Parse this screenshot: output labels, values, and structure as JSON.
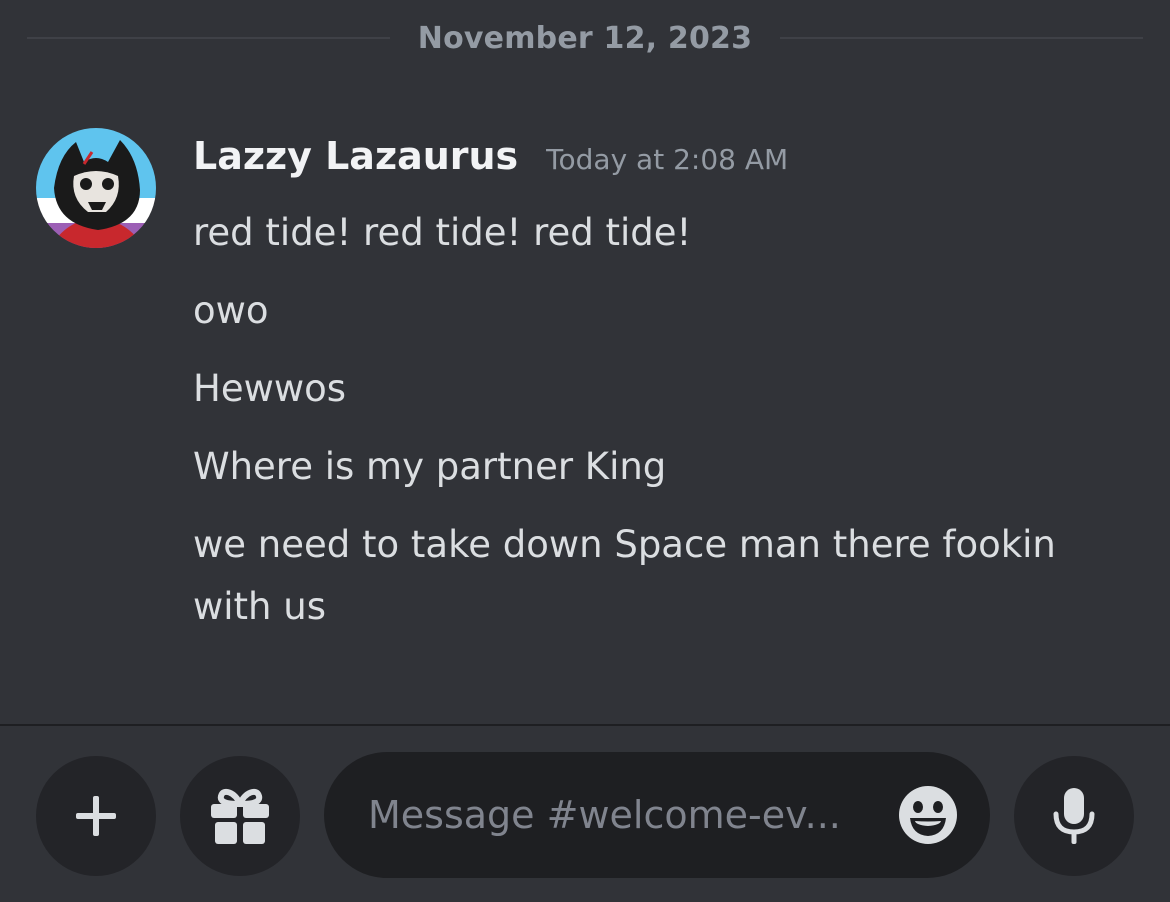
{
  "divider": {
    "date": "November 12, 2023"
  },
  "message": {
    "author": "Lazzy Lazaurus",
    "timestamp": "Today at 2:08 AM",
    "lines": [
      "red tide! red tide! red tide!",
      "owo",
      "Hewwos",
      "Where is my partner King",
      "we need to take down Space man there fookin with us"
    ]
  },
  "composer": {
    "placeholder": "Message #welcome-ev...",
    "icons": {
      "attach": "plus-icon",
      "gift": "gift-icon",
      "emoji": "emoji-smile-icon",
      "voice": "microphone-icon"
    }
  },
  "colors": {
    "background": "#313338",
    "input_background": "#1e1f22",
    "button_background": "#232428",
    "username": "#f2f3f5",
    "muted": "#949ba4",
    "message_text": "#dbdee1"
  }
}
